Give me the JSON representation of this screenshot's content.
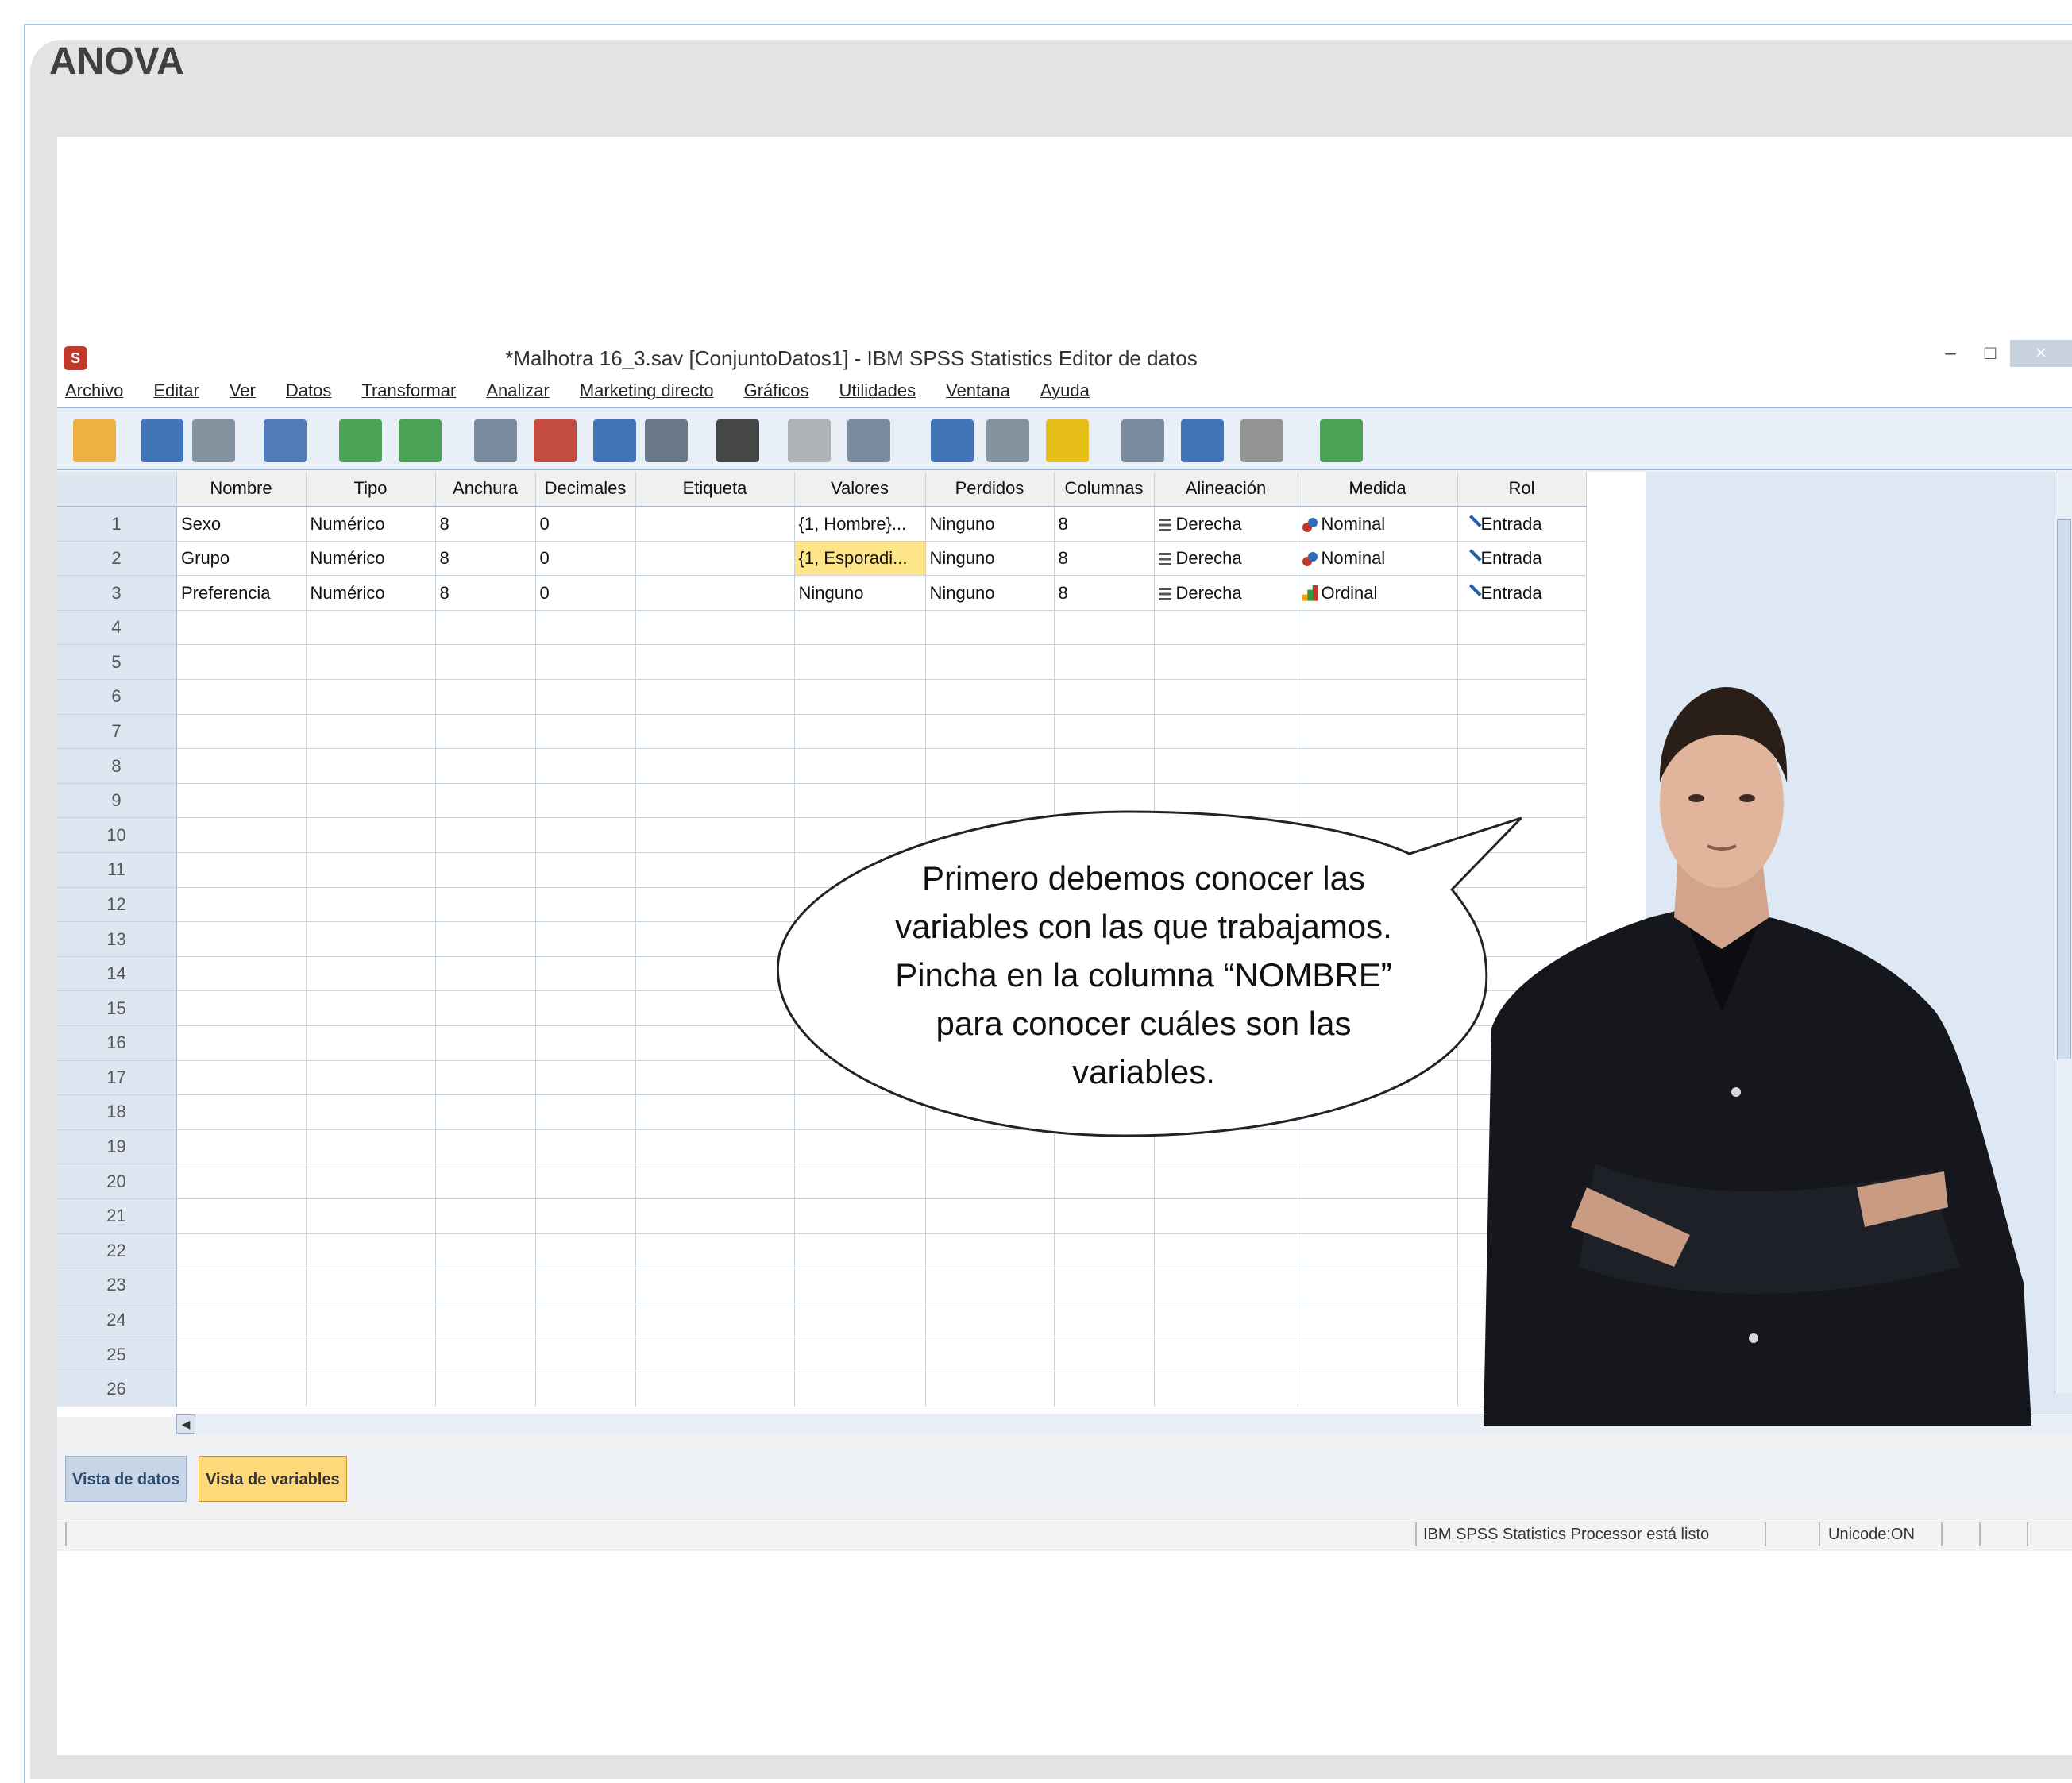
{
  "card": {
    "title": "ANOVA"
  },
  "window": {
    "title": "*Malhotra 16_3.sav [ConjuntoDatos1] - IBM SPSS Statistics Editor de datos",
    "controls": [
      "–",
      "□",
      "×"
    ]
  },
  "menu": [
    "Archivo",
    "Editar",
    "Ver",
    "Datos",
    "Transformar",
    "Analizar",
    "Marketing directo",
    "Gráficos",
    "Utilidades",
    "Ventana",
    "Ayuda"
  ],
  "toolbar_icons": [
    "open-folder-icon",
    "save-icon",
    "print-icon",
    "dialog-recall-icon",
    "undo-icon",
    "redo-icon",
    "goto-case-icon",
    "goto-variable-icon",
    "variables-icon",
    "run-descriptives-icon",
    "find-icon",
    "insert-cases-icon",
    "insert-variable-icon",
    "split-file-icon",
    "weight-cases-icon",
    "select-cases-icon",
    "value-labels-icon",
    "use-sets-icon",
    "show-all-variables-icon",
    "spell-check-icon"
  ],
  "columns": [
    "Nombre",
    "Tipo",
    "Anchura",
    "Decimales",
    "Etiqueta",
    "Valores",
    "Perdidos",
    "Columnas",
    "Alineación",
    "Medida",
    "Rol"
  ],
  "rows": [
    {
      "n": "1",
      "cells": [
        "Sexo",
        "Numérico",
        "8",
        "0",
        "",
        "{1, Hombre}...",
        "Ninguno",
        "8",
        "Derecha",
        "Nominal",
        "Entrada"
      ],
      "measure_icon": "nominal"
    },
    {
      "n": "2",
      "cells": [
        "Grupo",
        "Numérico",
        "8",
        "0",
        "",
        "{1, Esporadi...",
        "Ninguno",
        "8",
        "Derecha",
        "Nominal",
        "Entrada"
      ],
      "measure_icon": "nominal",
      "highlight_col": 5
    },
    {
      "n": "3",
      "cells": [
        "Preferencia",
        "Numérico",
        "8",
        "0",
        "",
        "Ninguno",
        "Ninguno",
        "8",
        "Derecha",
        "Ordinal",
        "Entrada"
      ],
      "measure_icon": "ordinal"
    }
  ],
  "empty_row_numbers": [
    "4",
    "5",
    "6",
    "7",
    "8",
    "9",
    "10",
    "11",
    "12",
    "13",
    "14",
    "15",
    "16",
    "17",
    "18",
    "19",
    "20",
    "21",
    "22",
    "23",
    "24",
    "25",
    "26"
  ],
  "tabs": {
    "data_view": "Vista de datos",
    "variable_view": "Vista de variables"
  },
  "status": {
    "processor": "IBM SPSS Statistics Processor está listo",
    "unicode": "Unicode:ON"
  },
  "bubble": {
    "lines": [
      "Primero debemos conocer las",
      "variables con las que trabajamos.",
      "Pincha en la columna “NOMBRE”",
      "para conocer cuáles son las",
      "variables."
    ]
  }
}
